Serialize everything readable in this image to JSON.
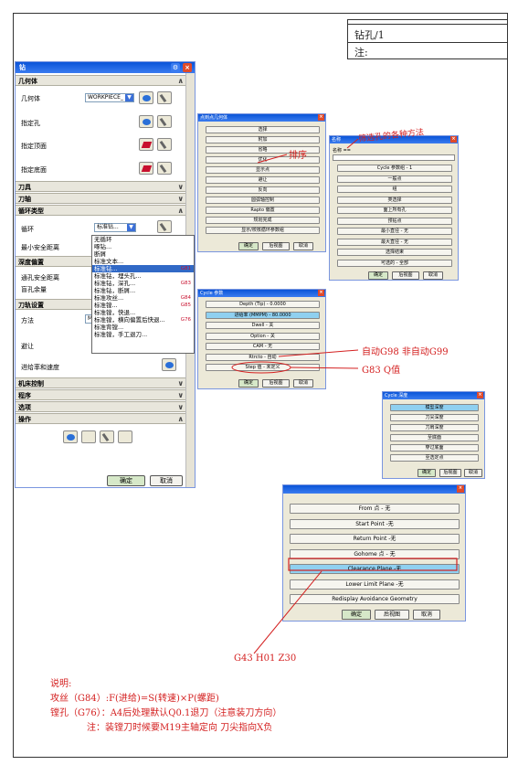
{
  "header": {
    "title": "钻孔/1",
    "note": "注:"
  },
  "main_dialog": {
    "title": "钻",
    "sections": {
      "geometry": "几何体",
      "tool": "刀具",
      "axis": "刀轴",
      "cycle_type": "循环类型",
      "depth_offset": "深度偏置",
      "tool_settings": "刀轨设置",
      "machine_control": "机床控制",
      "program": "程序",
      "options": "选项",
      "actions": "操作"
    },
    "labels": {
      "geometry_body": "几何体",
      "geometry_value": "WORKPIECE_",
      "specify_hole": "指定孔",
      "specify_top": "指定顶面",
      "specify_bottom": "指定底面",
      "cycle": "循环",
      "cycle_value": "标准钻...",
      "min_clearance": "最小安全距离",
      "through_clearance": "通孔安全距离",
      "blind_stock": "盲孔余量",
      "method": "方法",
      "method_value": "M",
      "avoid": "避让",
      "feeds": "进给率和速度"
    },
    "ok": "确定",
    "cancel": "取消",
    "cycle_menu": [
      {
        "label": "无循环",
        "code": ""
      },
      {
        "label": "啄钻...",
        "code": ""
      },
      {
        "label": "断屑",
        "code": ""
      },
      {
        "label": "标准文本...",
        "code": ""
      },
      {
        "label": "标准钻...",
        "code": "G81"
      },
      {
        "label": "标准钻，埋头孔...",
        "code": ""
      },
      {
        "label": "标准钻，深孔...",
        "code": "G83"
      },
      {
        "label": "标准钻，断屑...",
        "code": ""
      },
      {
        "label": "标准攻丝...",
        "code": "G84"
      },
      {
        "label": "标准镗...",
        "code": "G85"
      },
      {
        "label": "标准镗，快退...",
        "code": ""
      },
      {
        "label": "标准镗，横向偏置后快退...",
        "code": "G76"
      },
      {
        "label": "标准背镗...",
        "code": ""
      },
      {
        "label": "标准镗，手工退刀...",
        "code": ""
      }
    ]
  },
  "geom_dialog": {
    "title": "点到点几何体",
    "rows": [
      "选择",
      "附加",
      "省略",
      "优化",
      "显示点",
      "避让",
      "反向",
      "圆弧轴控制",
      "Rapto 偏置",
      "规划完成",
      "显示/校核循环参数组"
    ],
    "ok": "确定",
    "back": "后视图",
    "cancel": "取消"
  },
  "name_dialog": {
    "title": "名称",
    "name_label": "名称 ==",
    "rows": [
      "Cycle 参数组 - 1",
      "一般点",
      "组",
      "类选择",
      "面上所有孔",
      "预钻点",
      "最小直径 - 无",
      "最大直径 - 无",
      "选择结束",
      "可选的 - 全部"
    ],
    "ok": "确定",
    "back": "后视图",
    "cancel": "取消"
  },
  "cycle_params_dialog": {
    "title": "Cycle 参数",
    "rows": [
      "Depth (Tip) - 0.0000",
      "进给率 (MMPM) - 80.0000",
      "Dwell - 关",
      "Option - 关",
      "CAM - 无",
      "Rtrcto - 自动",
      "Step 值 - 未定义"
    ],
    "ok": "确定",
    "back": "后视图",
    "cancel": "取消"
  },
  "cycle_depth_dialog": {
    "title": "Cycle 深度",
    "rows": [
      "模型深度",
      "刀尖深度",
      "刀肩深度",
      "至底面",
      "穿过底面",
      "至选定点"
    ],
    "ok": "确定",
    "back": "后视图",
    "cancel": "取消"
  },
  "points_dialog": {
    "rows": [
      "From 点 - 无",
      "Start Point -无",
      "Return Point -无",
      "Gohome 点 - 无",
      "Clearance Plane -无",
      "Lower Limit Plane -无",
      "Redisplay Avoidance Geometry"
    ],
    "ok": "确定",
    "back": "后视图",
    "cancel": "取消"
  },
  "annotations": {
    "sort": "排序",
    "filter": "筛选孔的各种方法",
    "auto_g98": "自动G98 非自动G99",
    "g83_q": "G83 Q值",
    "g43": "G43 H01 Z30"
  },
  "notes": {
    "title": "说明:",
    "line1": "攻丝（G84）:F(进给)=S(转速)×P(螺距)",
    "line2": "镗孔（G76）：A4后处理默认Q0.1退刀（注意装刀方向）",
    "line3": "注：装镗刀时候要M19主轴定向 刀尖指向X负"
  }
}
